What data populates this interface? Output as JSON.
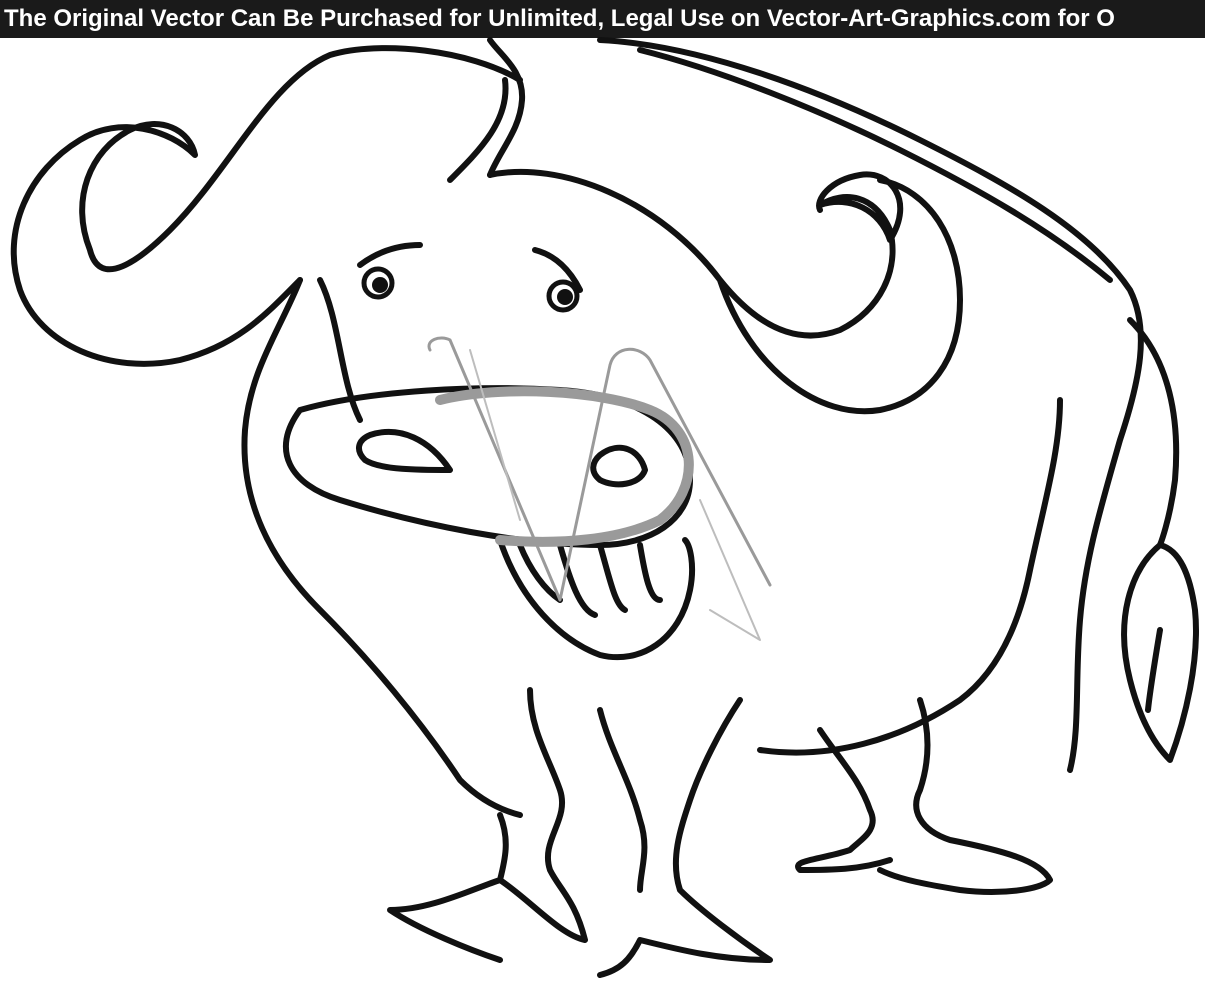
{
  "banner": {
    "text": "The Original Vector Can Be Purchased for Unlimited, Legal Use on Vector-Art-Graphics.com for O"
  },
  "illustration": {
    "subject": "buffalo",
    "style": "black line art coloring page",
    "watermark": "VA",
    "colors": {
      "ink": "#111111",
      "background": "#ffffff",
      "banner_bg": "#1a1a1a",
      "banner_text": "#ffffff",
      "watermark": "#9a9a9a"
    }
  }
}
